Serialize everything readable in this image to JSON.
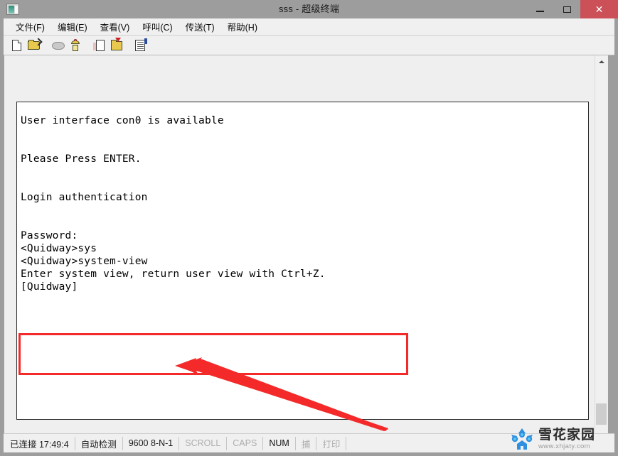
{
  "window": {
    "title": "sss - 超级终端",
    "app_icon": "terminal-icon",
    "buttons": {
      "minimize": "—",
      "maximize": "▢",
      "close": "✕"
    }
  },
  "menubar": {
    "items": [
      {
        "label": "文件(F)",
        "name": "menu-file"
      },
      {
        "label": "编辑(E)",
        "name": "menu-edit"
      },
      {
        "label": "查看(V)",
        "name": "menu-view"
      },
      {
        "label": "呼叫(C)",
        "name": "menu-call"
      },
      {
        "label": "传送(T)",
        "name": "menu-transfer"
      },
      {
        "label": "帮助(H)",
        "name": "menu-help"
      }
    ]
  },
  "toolbar": {
    "buttons": [
      {
        "name": "new-connection-icon"
      },
      {
        "name": "open-file-icon"
      },
      {
        "name": "disconnect-phone-icon"
      },
      {
        "name": "call-phone-icon"
      },
      {
        "name": "send-file-icon"
      },
      {
        "name": "receive-file-icon"
      },
      {
        "name": "properties-icon"
      }
    ]
  },
  "terminal": {
    "content": "User interface con0 is available\n\n\nPlease Press ENTER.\n\n\nLogin authentication\n\n\nPassword:\n<Quidway>sys\n<Quidway>system-view\nEnter system view, return user view with Ctrl+Z.\n[Quidway]",
    "lines": [
      "User interface con0 is available",
      "",
      "",
      "Please Press ENTER.",
      "",
      "",
      "Login authentication",
      "",
      "",
      "Password:",
      "<Quidway>sys",
      "<Quidway>system-view",
      "Enter system view, return user view with Ctrl+Z.",
      "[Quidway]"
    ]
  },
  "annotation": {
    "highlight_color": "#f42a2a",
    "highlight_target": "<Quidway>system-view / Enter system view, return user view with Ctrl+Z. / [Quidway]",
    "arrow": "points-up-left-to-highlighted-block"
  },
  "statusbar": {
    "connection": "已连接 17:49:4",
    "detection": "自动检测",
    "serial": "9600 8-N-1",
    "scroll": "SCROLL",
    "caps": "CAPS",
    "num": "NUM",
    "capture": "捕",
    "print": "打印"
  },
  "scrollbar": {
    "up_arrow": "chevron-up-icon"
  },
  "watermark": {
    "title": "雪花家园",
    "url": "www.xhjaty.com",
    "logo": "snowflake-icon",
    "color": "#2f8fe0"
  }
}
